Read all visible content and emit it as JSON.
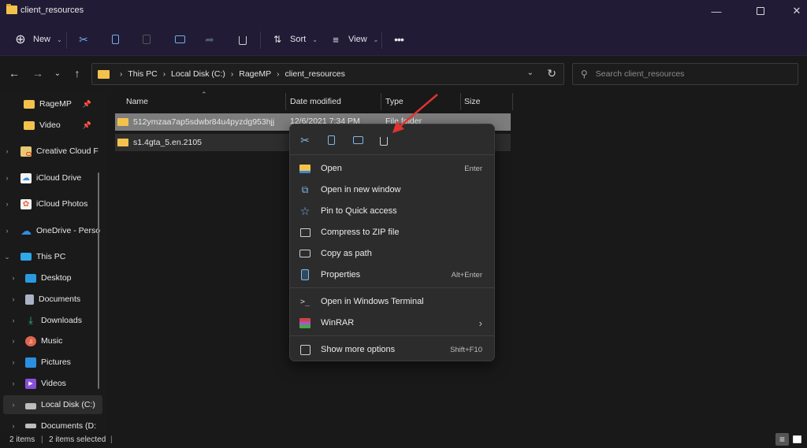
{
  "window": {
    "title": "client_resources",
    "minimize_icon": "minimize-icon",
    "maximize_icon": "maximize-icon",
    "close_icon": "close-icon"
  },
  "toolbar": {
    "new_label": "New",
    "sort_label": "Sort",
    "view_label": "View",
    "icons": [
      "new-icon",
      "cut-icon",
      "copy-icon",
      "paste-icon",
      "rename-icon",
      "share-icon",
      "delete-icon",
      "sort-icon",
      "view-icon",
      "more-icon"
    ]
  },
  "nav": {
    "breadcrumb": [
      "This PC",
      "Local Disk (C:)",
      "RageMP",
      "client_resources"
    ],
    "search_placeholder": "Search client_resources"
  },
  "sidebar": {
    "items": [
      {
        "label": "RageMP",
        "icon": "folder-icon",
        "pinned": true
      },
      {
        "label": "Video",
        "icon": "folder-icon",
        "pinned": true
      },
      {
        "label": "Creative Cloud F",
        "icon": "creative-cloud-icon"
      },
      {
        "label": "iCloud Drive",
        "icon": "icloud-drive-icon"
      },
      {
        "label": "iCloud Photos",
        "icon": "icloud-photos-icon"
      },
      {
        "label": "OneDrive - Perso",
        "icon": "onedrive-icon"
      },
      {
        "label": "This PC",
        "icon": "this-pc-icon",
        "expanded": true
      },
      {
        "label": "Desktop",
        "icon": "desktop-icon"
      },
      {
        "label": "Documents",
        "icon": "documents-icon"
      },
      {
        "label": "Downloads",
        "icon": "downloads-icon"
      },
      {
        "label": "Music",
        "icon": "music-icon"
      },
      {
        "label": "Pictures",
        "icon": "pictures-icon"
      },
      {
        "label": "Videos",
        "icon": "videos-icon"
      },
      {
        "label": "Local Disk (C:)",
        "icon": "local-disk-icon",
        "selected": true
      },
      {
        "label": "Documents (D:",
        "icon": "drive-icon"
      }
    ]
  },
  "files": {
    "columns": [
      "Name",
      "Date modified",
      "Type",
      "Size"
    ],
    "rows": [
      {
        "name": "512ymzaa7ap5sdwbr84u4pyzdg953hjj",
        "date": "12/6/2021 7:34 PM",
        "type": "File folder",
        "size": ""
      },
      {
        "name": "s1.4gta_5.en.2105",
        "date": "",
        "type": "",
        "size": ""
      }
    ]
  },
  "context_menu": {
    "quick_actions": [
      "cut-icon",
      "copy-icon",
      "rename-icon",
      "delete-icon"
    ],
    "items": [
      {
        "label": "Open",
        "shortcut": "Enter",
        "icon": "open-folder-icon"
      },
      {
        "label": "Open in new window",
        "shortcut": "",
        "icon": "open-new-window-icon"
      },
      {
        "label": "Pin to Quick access",
        "shortcut": "",
        "icon": "star-icon"
      },
      {
        "label": "Compress to ZIP file",
        "shortcut": "",
        "icon": "zip-icon"
      },
      {
        "label": "Copy as path",
        "shortcut": "",
        "icon": "copy-path-icon"
      },
      {
        "label": "Properties",
        "shortcut": "Alt+Enter",
        "icon": "properties-icon"
      },
      {
        "label": "Open in Windows Terminal",
        "shortcut": "",
        "icon": "terminal-icon"
      },
      {
        "label": "WinRAR",
        "shortcut": "",
        "icon": "winrar-icon",
        "submenu": true
      },
      {
        "label": "Show more options",
        "shortcut": "Shift+F10",
        "icon": "more-options-icon"
      }
    ]
  },
  "status": {
    "items_count": "2 items",
    "selected_count": "2 items selected"
  },
  "colors": {
    "title_bg": "#211b35",
    "accent_blue": "#7fb6e8",
    "folder_yellow": "#f3c24c",
    "annotation_arrow": "#e0342f"
  }
}
